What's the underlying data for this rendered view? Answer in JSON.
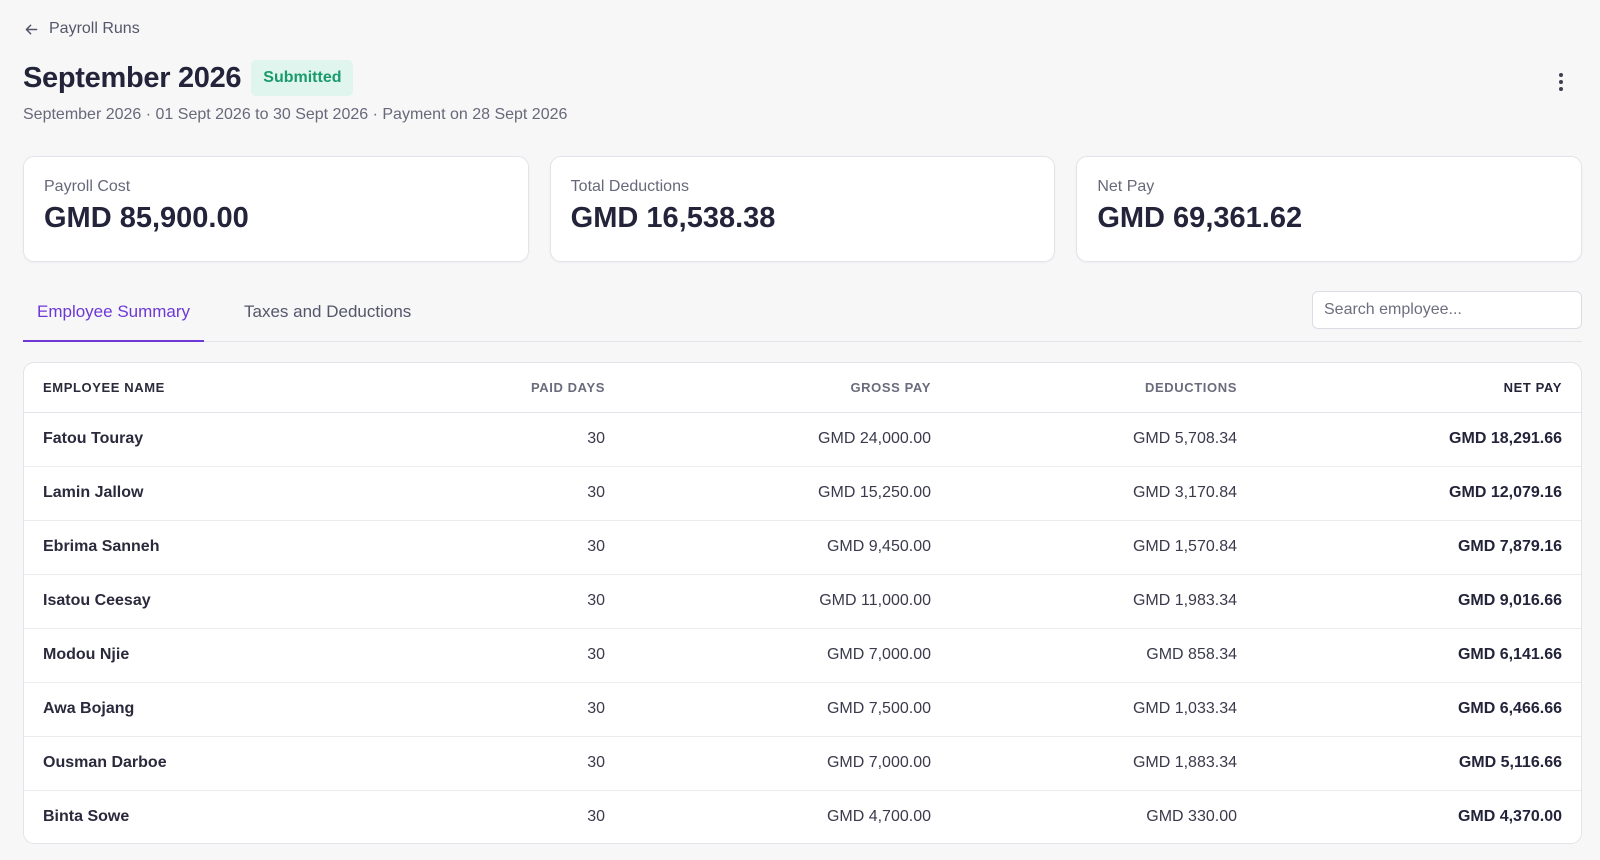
{
  "breadcrumb": {
    "back_label": "Payroll Runs"
  },
  "header": {
    "title": "September 2026",
    "status": "Submitted",
    "subtitle": "September 2026 · 01 Sept 2026 to 30 Sept 2026 · Payment on 28 Sept 2026"
  },
  "stats": [
    {
      "label": "Payroll Cost",
      "value": "GMD 85,900.00"
    },
    {
      "label": "Total Deductions",
      "value": "GMD 16,538.38"
    },
    {
      "label": "Net Pay",
      "value": "GMD 69,361.62"
    }
  ],
  "tabs": [
    {
      "label": "Employee Summary",
      "active": true
    },
    {
      "label": "Taxes and Deductions",
      "active": false
    }
  ],
  "search": {
    "placeholder": "Search employee...",
    "value": ""
  },
  "table": {
    "columns": [
      "Employee Name",
      "Paid Days",
      "Gross Pay",
      "Deductions",
      "Net Pay"
    ],
    "rows": [
      {
        "name": "Fatou Touray",
        "paid_days": "30",
        "gross": "GMD 24,000.00",
        "deductions": "GMD 5,708.34",
        "net": "GMD 18,291.66"
      },
      {
        "name": "Lamin Jallow",
        "paid_days": "30",
        "gross": "GMD 15,250.00",
        "deductions": "GMD 3,170.84",
        "net": "GMD 12,079.16"
      },
      {
        "name": "Ebrima Sanneh",
        "paid_days": "30",
        "gross": "GMD 9,450.00",
        "deductions": "GMD 1,570.84",
        "net": "GMD 7,879.16"
      },
      {
        "name": "Isatou Ceesay",
        "paid_days": "30",
        "gross": "GMD 11,000.00",
        "deductions": "GMD 1,983.34",
        "net": "GMD 9,016.66"
      },
      {
        "name": "Modou Njie",
        "paid_days": "30",
        "gross": "GMD 7,000.00",
        "deductions": "GMD 858.34",
        "net": "GMD 6,141.66"
      },
      {
        "name": "Awa Bojang",
        "paid_days": "30",
        "gross": "GMD 7,500.00",
        "deductions": "GMD 1,033.34",
        "net": "GMD 6,466.66"
      },
      {
        "name": "Ousman Darboe",
        "paid_days": "30",
        "gross": "GMD 7,000.00",
        "deductions": "GMD 1,883.34",
        "net": "GMD 5,116.66"
      },
      {
        "name": "Binta Sowe",
        "paid_days": "30",
        "gross": "GMD 4,700.00",
        "deductions": "GMD 330.00",
        "net": "GMD 4,370.00"
      }
    ]
  },
  "icons": {
    "back": "arrow-left-icon",
    "more": "kebab-menu-icon"
  },
  "colors": {
    "accent": "#6d38d6",
    "status_bg": "#dff5ee",
    "status_text": "#1a9b6c"
  }
}
